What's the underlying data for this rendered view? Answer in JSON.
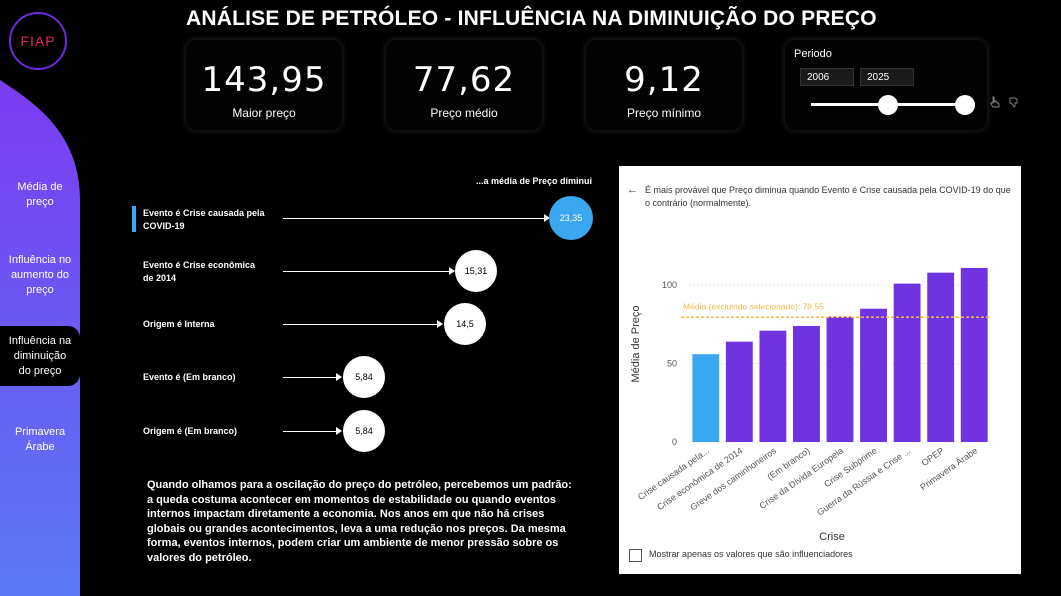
{
  "brand": {
    "logo_text": "FIAP",
    "gradient_top": "#7a3cf0",
    "gradient_bottom": "#5a7af5"
  },
  "title": "ANÁLISE DE PETRÓLEO - INFLUÊNCIA NA DIMINUIÇÃO DO PREÇO",
  "nav": {
    "items": [
      {
        "label_lines": [
          "Média de",
          "preço"
        ],
        "active": false
      },
      {
        "label_lines": [
          "Influência no",
          "aumento do",
          "preço"
        ],
        "active": false
      },
      {
        "label_lines": [
          "Influência na",
          "diminuição",
          "do preço"
        ],
        "active": true
      },
      {
        "label_lines": [
          "Primavera",
          "Árabe"
        ],
        "active": false
      }
    ]
  },
  "kpis": [
    {
      "value": "143,95",
      "label": "Maior preço"
    },
    {
      "value": "77,62",
      "label": "Preço médio"
    },
    {
      "value": "9,12",
      "label": "Preço mínimo"
    }
  ],
  "period": {
    "label": "Periodo",
    "start": "2006",
    "end": "2025",
    "start_fraction": 0.5,
    "end_fraction": 1.0,
    "icons": [
      "hand-pointer-icon",
      "thumbs-down-icon"
    ]
  },
  "influencers": {
    "header": "...a média de Preço diminui",
    "items": [
      {
        "label_lines": [
          "Evento é Crise causada pela",
          "COVID-19"
        ],
        "value": "23,35",
        "selected": true,
        "color": "#3aa7f0"
      },
      {
        "label_lines": [
          "Evento é Crise econômica",
          "de 2014"
        ],
        "value": "15,31",
        "selected": false,
        "color": "#ffffff"
      },
      {
        "label_lines": [
          "Origem é Interna"
        ],
        "value": "14,5",
        "selected": false,
        "color": "#ffffff"
      },
      {
        "label_lines": [
          "Evento é (Em branco)"
        ],
        "value": "5,84",
        "selected": false,
        "color": "#ffffff"
      },
      {
        "label_lines": [
          "Origem é (Em branco)"
        ],
        "value": "5,84",
        "selected": false,
        "color": "#ffffff"
      }
    ]
  },
  "narrative": "Quando olhamos para a oscilação do preço do petróleo, percebemos um padrão: a queda costuma acontecer em momentos de estabilidade ou quando eventos internos impactam diretamente a economia. Nos anos em que não há crises globais ou grandes acontecimentos, leva a uma redução nos preços. Da mesma forma, eventos internos, podem criar um ambiente de menor pressão sobre os valores do petróleo.",
  "chart_panel": {
    "back_icon": "back-arrow-icon",
    "description": "É mais provável que Preço diminua quando Evento é Crise causada pela COVID-19 do que o contrário (normalmente).",
    "checkbox_label": "Mostrar apenas os valores que são influenciadores"
  },
  "chart_data": {
    "type": "bar",
    "categories": [
      "Crise causada pela...",
      "Crise econômica de 2014",
      "Greve dos caminhoneiros",
      "(Em branco)",
      "Crise da Dívida Europeia",
      "Crise Subprime",
      "Guerra da Rússia e Crise ...",
      "OPEP",
      "Primavera Árabe"
    ],
    "values": [
      56,
      64,
      71,
      74,
      80,
      85,
      101,
      108,
      111
    ],
    "highlight_index": 0,
    "highlight_color": "#3aa7f0",
    "bar_color": "#7033e0",
    "xlabel": "Crise",
    "ylabel": "Média de Preço",
    "ylim": [
      0,
      125
    ],
    "yticks": [
      "0",
      "50",
      "100"
    ],
    "ytick_values": [
      0,
      50,
      100
    ],
    "reference_line": {
      "label": "Média (excluindo selecionado): 79,55",
      "value": 79.55,
      "color": "#f2b84b"
    },
    "grid": true
  }
}
